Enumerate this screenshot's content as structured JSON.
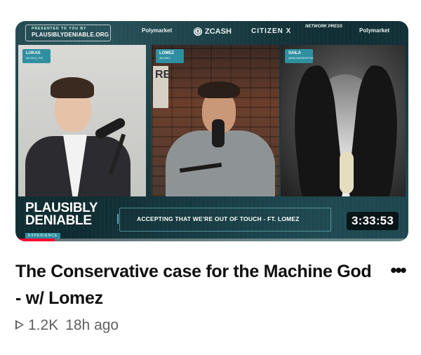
{
  "video": {
    "title": "The Conservative case for the Machine God - w/ Lomez",
    "views": "1.2K",
    "age": "18h ago",
    "duration": "3:33:53",
    "watch_progress": 0.1
  },
  "thumbnail": {
    "presented_by": "PRESENTED TO YOU BY",
    "site": "PLAUSIBLYDENIABLE.ORG",
    "sponsors": [
      "Polymarket",
      "ZCASH",
      "CITIZEN X",
      "NETWORK PRESS",
      "Polymarket"
    ],
    "hosts": [
      {
        "name": "LUKAS",
        "handle": "@LUKAS_FRG"
      },
      {
        "name": "LOMEZ",
        "handle": "@LOMEZ"
      },
      {
        "name": "SAILA",
        "handle": "@SAILAMENRAPTOR"
      }
    ],
    "sign_text": "RE",
    "show_line1": "PLAUSIBLY",
    "show_line2": "DENIABLE",
    "show_tag": "EXPERIENCE",
    "episode_title": "ACCEPTING THAT WE'RE OUT OF TOUCH - FT. LOMEZ"
  },
  "menu": {
    "more_label": "•••"
  },
  "icons": {
    "play": "play-outline-icon",
    "more": "more-vertical-icon"
  },
  "colors": {
    "accent_teal": "#2f8fa0",
    "progress_red": "#ff0033",
    "meta_gray": "#606060"
  }
}
